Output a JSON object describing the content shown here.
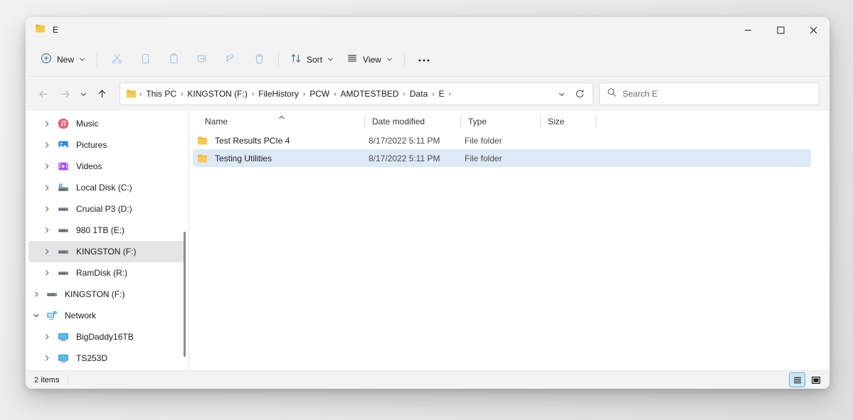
{
  "window": {
    "title": "E",
    "folder_icon": "folder-icon",
    "controls": {
      "minimize": "minimize-icon",
      "maximize": "maximize-icon",
      "close": "close-icon"
    }
  },
  "toolbar": {
    "new_label": "New",
    "sort_label": "Sort",
    "view_label": "View",
    "more_label": "•••",
    "items": [
      {
        "name": "cut-icon",
        "label": "Cut"
      },
      {
        "name": "copy-icon",
        "label": "Copy"
      },
      {
        "name": "paste-icon",
        "label": "Paste"
      },
      {
        "name": "rename-icon",
        "label": "Rename"
      },
      {
        "name": "share-icon",
        "label": "Share"
      },
      {
        "name": "delete-icon",
        "label": "Delete"
      }
    ]
  },
  "navigation": {
    "back": "back-arrow-icon",
    "forward": "forward-arrow-icon",
    "recent": "chevron-down-icon",
    "up": "up-arrow-icon"
  },
  "breadcrumb": {
    "icon": "folder-icon",
    "items": [
      "This PC",
      "KINGSTON (F:)",
      "FileHistory",
      "PCW",
      "AMDTESTBED",
      "Data",
      "E"
    ],
    "separator": "›",
    "dropdown": "chevron-down-icon",
    "refresh": "refresh-icon"
  },
  "search": {
    "placeholder": "Search E",
    "icon": "search-icon"
  },
  "sidebar": {
    "items": [
      {
        "label": "Music",
        "icon": "music-icon",
        "depth": 1,
        "expandable": true,
        "expanded": false,
        "selected": false
      },
      {
        "label": "Pictures",
        "icon": "pictures-icon",
        "depth": 1,
        "expandable": true,
        "expanded": false,
        "selected": false
      },
      {
        "label": "Videos",
        "icon": "videos-icon",
        "depth": 1,
        "expandable": true,
        "expanded": false,
        "selected": false
      },
      {
        "label": "Local Disk (C:)",
        "icon": "localdisk-icon",
        "depth": 1,
        "expandable": true,
        "expanded": false,
        "selected": false
      },
      {
        "label": "Crucial P3 (D:)",
        "icon": "drive-icon",
        "depth": 1,
        "expandable": true,
        "expanded": false,
        "selected": false
      },
      {
        "label": "980 1TB (E:)",
        "icon": "drive-icon",
        "depth": 1,
        "expandable": true,
        "expanded": false,
        "selected": false
      },
      {
        "label": "KINGSTON (F:)",
        "icon": "drive-icon",
        "depth": 1,
        "expandable": true,
        "expanded": false,
        "selected": true
      },
      {
        "label": "RamDisk (R:)",
        "icon": "drive-icon",
        "depth": 1,
        "expandable": true,
        "expanded": false,
        "selected": false
      },
      {
        "label": "KINGSTON (F:)",
        "icon": "drive-icon",
        "depth": 0,
        "expandable": true,
        "expanded": false,
        "selected": false
      },
      {
        "label": "Network",
        "icon": "network-icon",
        "depth": 0,
        "expandable": true,
        "expanded": true,
        "selected": false
      },
      {
        "label": "BigDaddy16TB",
        "icon": "computer-icon",
        "depth": 1,
        "expandable": true,
        "expanded": false,
        "selected": false
      },
      {
        "label": "TS253D",
        "icon": "computer-icon",
        "depth": 1,
        "expandable": true,
        "expanded": false,
        "selected": false
      }
    ]
  },
  "filelist": {
    "columns": [
      {
        "label": "Name",
        "sorted": true,
        "sort_direction": "asc"
      },
      {
        "label": "Date modified",
        "sorted": false,
        "sort_direction": ""
      },
      {
        "label": "Type",
        "sorted": false,
        "sort_direction": ""
      },
      {
        "label": "Size",
        "sorted": false,
        "sort_direction": ""
      }
    ],
    "rows": [
      {
        "icon": "folder-icon",
        "name": "Test Results PCIe 4",
        "date_modified": "8/17/2022 5:11 PM",
        "type": "File folder",
        "size": "",
        "selected": false
      },
      {
        "icon": "folder-icon",
        "name": "Testing Utilities",
        "date_modified": "8/17/2022 5:11 PM",
        "type": "File folder",
        "size": "",
        "selected": true
      }
    ]
  },
  "statusbar": {
    "item_count": "2 items",
    "views": [
      {
        "name": "details-view-icon",
        "label": "Details view",
        "active": true
      },
      {
        "name": "large-icons-view-icon",
        "label": "Large icons view",
        "active": false
      }
    ]
  },
  "colors": {
    "chrome": "#f3f3f3",
    "surface": "#ffffff",
    "selection": "#dceaf7",
    "sidebar_selection": "#e4e4e4",
    "accent": "#5aaee0",
    "folder_yellow": "#f7c860",
    "text": "#1b1b1b"
  }
}
